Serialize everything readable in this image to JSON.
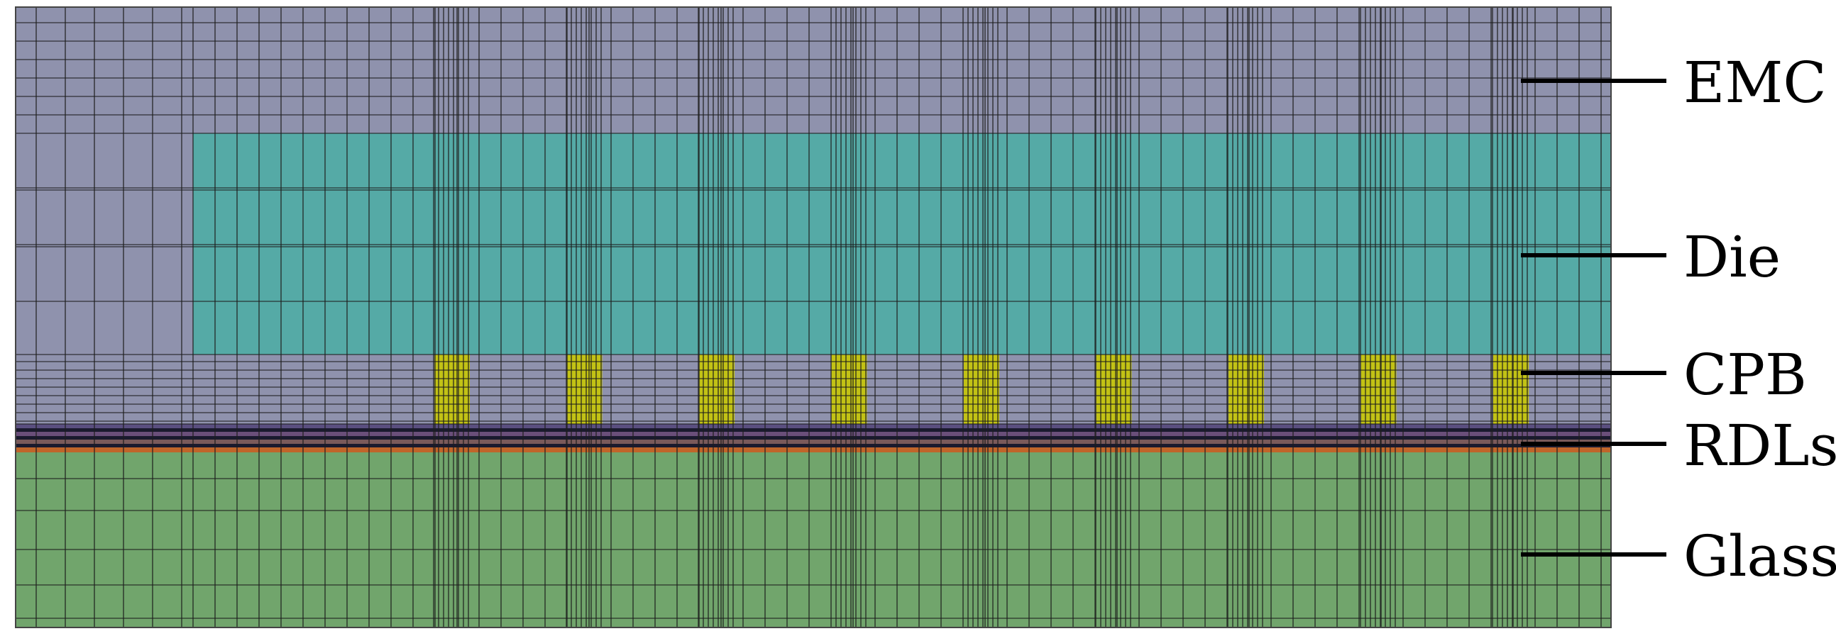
{
  "labels": {
    "emc": "EMC",
    "die": "Die",
    "cpb": "CPB",
    "rdls": "RDLs",
    "glass": "Glass"
  },
  "colors": {
    "emc": "#8f92ad",
    "die": "#55aaa6",
    "cpb_bump": "#c2c215",
    "glass": "#71a56c",
    "rdl_dark": "#1a1a2e",
    "rdl_purple": "#6a4f7a",
    "rdl_orange": "#c0652a",
    "mesh_line": "#1e1e1e",
    "frame": "#444444"
  },
  "bump_count": 9
}
